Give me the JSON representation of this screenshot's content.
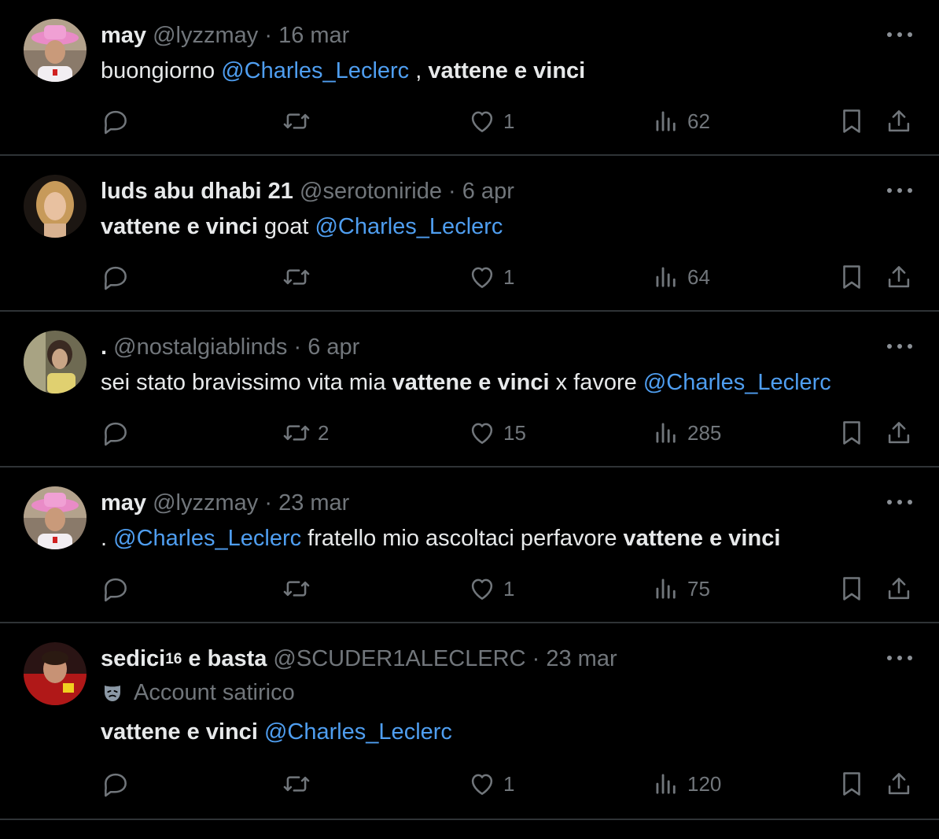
{
  "tweets": [
    {
      "name": "may",
      "name_sup": "",
      "handle": "@lyzzmay",
      "date": "16 mar",
      "text_parts": [
        {
          "t": "buongiorno ",
          "bold": false,
          "mention": false
        },
        {
          "t": "@Charles_Leclerc",
          "bold": false,
          "mention": true
        },
        {
          "t": " , ",
          "bold": false,
          "mention": false
        },
        {
          "t": "vattene e vinci",
          "bold": true,
          "mention": false
        }
      ],
      "replies": "",
      "retweets": "",
      "likes": "1",
      "views": "62"
    },
    {
      "name": "luds abu dhabi 21",
      "name_sup": "",
      "handle": "@serotoniride",
      "date": "6 apr",
      "text_parts": [
        {
          "t": "vattene e vinci",
          "bold": true,
          "mention": false
        },
        {
          "t": " goat ",
          "bold": false,
          "mention": false
        },
        {
          "t": "@Charles_Leclerc",
          "bold": false,
          "mention": true
        }
      ],
      "replies": "",
      "retweets": "",
      "likes": "1",
      "views": "64"
    },
    {
      "name": ".",
      "name_sup": "",
      "handle": "@nostalgiablinds",
      "date": "6 apr",
      "text_parts": [
        {
          "t": "sei stato bravissimo vita mia ",
          "bold": false,
          "mention": false
        },
        {
          "t": "vattene e vinci",
          "bold": true,
          "mention": false
        },
        {
          "t": " x favore ",
          "bold": false,
          "mention": false
        },
        {
          "t": "@Charles_Leclerc",
          "bold": false,
          "mention": true
        }
      ],
      "replies": "",
      "retweets": "2",
      "likes": "15",
      "views": "285"
    },
    {
      "name": "may",
      "name_sup": "",
      "handle": "@lyzzmay",
      "date": "23 mar",
      "text_parts": [
        {
          "t": ". ",
          "bold": false,
          "mention": false
        },
        {
          "t": "@Charles_Leclerc",
          "bold": false,
          "mention": true
        },
        {
          "t": " fratello mio ascoltaci perfavore ",
          "bold": false,
          "mention": false
        },
        {
          "t": "vattene e vinci",
          "bold": true,
          "mention": false
        }
      ],
      "replies": "",
      "retweets": "",
      "likes": "1",
      "views": "75"
    },
    {
      "name": "sedici",
      "name_sup": "16",
      "name_suffix": " e basta",
      "handle": "@SCUDER1ALECLERC",
      "date": "23 mar",
      "label": "Account satirico",
      "text_parts": [
        {
          "t": "vattene e vinci",
          "bold": true,
          "mention": false
        },
        {
          "t": " ",
          "bold": false,
          "mention": false
        },
        {
          "t": "@Charles_Leclerc",
          "bold": false,
          "mention": true
        }
      ],
      "replies": "",
      "retweets": "",
      "likes": "1",
      "views": "120"
    }
  ],
  "separator": " · ",
  "colors": {
    "background": "#000000",
    "text": "#e7e9ea",
    "muted": "#71767b",
    "mention": "#4f9ef0",
    "divider": "#2f3336"
  },
  "icons": [
    "reply-icon",
    "retweet-icon",
    "like-icon",
    "views-icon",
    "bookmark-icon",
    "share-icon",
    "more-icon",
    "satire-mask-icon"
  ]
}
